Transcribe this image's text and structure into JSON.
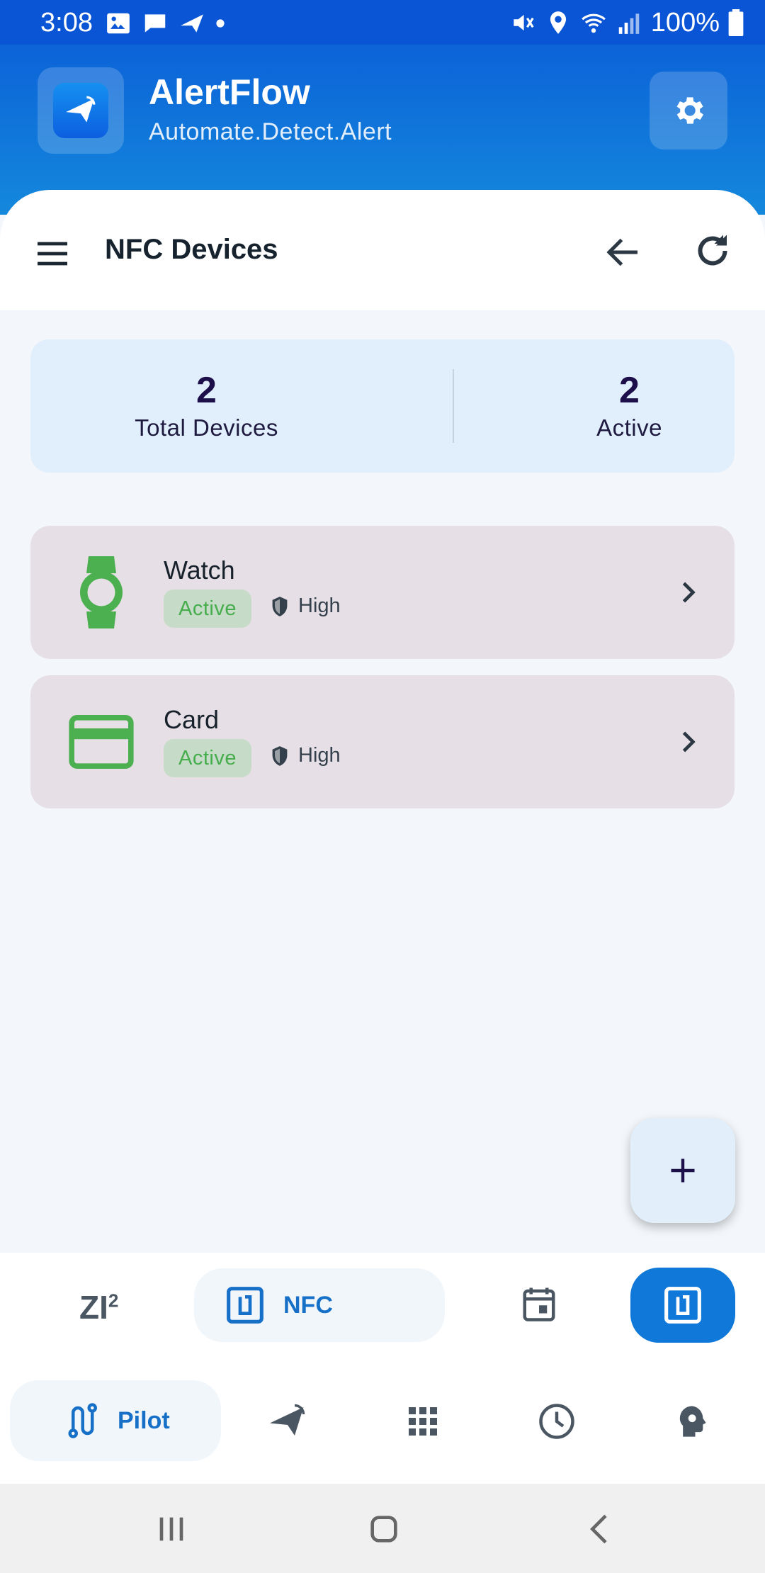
{
  "status_bar": {
    "time": "3:08",
    "battery": "100%",
    "icons_left": [
      "gallery-icon",
      "message-icon",
      "send-icon",
      "dot-icon"
    ],
    "icons_right": [
      "mute-icon",
      "location-icon",
      "wifi-icon",
      "signal-icon",
      "battery-icon"
    ]
  },
  "header": {
    "app_name": "AlertFlow",
    "tagline": "Automate.Detect.Alert",
    "logo_icon": "paper-plane-icon",
    "settings_icon": "gear-icon"
  },
  "toolbar": {
    "title": "NFC Devices",
    "menu_icon": "hamburger-menu-icon",
    "back_icon": "arrow-back-icon",
    "refresh_icon": "refresh-icon"
  },
  "stats": [
    {
      "value": "2",
      "label": "Total Devices"
    },
    {
      "value": "2",
      "label": "Active"
    }
  ],
  "devices": [
    {
      "name": "Watch",
      "status": "Active",
      "security": "High",
      "icon": "watch-icon"
    },
    {
      "name": "Card",
      "status": "Active",
      "security": "High",
      "icon": "credit-card-icon"
    }
  ],
  "fab": {
    "icon": "plus-icon"
  },
  "sub_nav": {
    "zi_label": "ZI",
    "zi_sup": "2",
    "nfc_label": "NFC",
    "items": [
      "zi-icon",
      "nfc-icon",
      "calendar-icon",
      "nfc-icon"
    ]
  },
  "bottom_nav": {
    "pilot_label": "Pilot",
    "items": [
      "route-icon",
      "paper-plane-icon",
      "grid-icon",
      "clock-icon",
      "brain-icon"
    ]
  },
  "colors": {
    "status_bar": "#0a55d6",
    "header_top": "#0c63d8",
    "header_bottom": "#1488dc",
    "accent": "#1770c8",
    "active_green": "#46ad4d",
    "device_card": "#e6e0e6",
    "stats_bg": "#e1eefb"
  }
}
